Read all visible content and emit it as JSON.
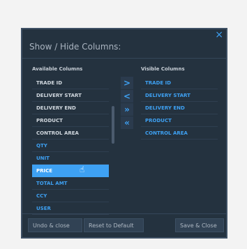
{
  "dialog": {
    "title": "Show / Hide Columns:",
    "close": "×",
    "available_title": "Available Columns",
    "visible_title": "Visible Columns",
    "available": [
      "TRADE ID",
      "DELIVERY START",
      "DELIVERY END",
      "PRODUCT",
      "CONTROL AREA",
      "QTY",
      "UNIT",
      "PRICE",
      "TOTAL AMT",
      "CCY",
      "USER"
    ],
    "visible": [
      "TRADE ID",
      "DELIVERY START",
      "DELIVERY END",
      "PRODUCT",
      "CONTROL AREA"
    ],
    "selected": "PRICE",
    "arrows": [
      ">",
      "<",
      "»",
      "«"
    ],
    "buttons": {
      "undo_close": "Undo & close",
      "reset": "Reset to Default",
      "save_close": "Save & Close"
    }
  },
  "colors": {
    "accent": "#3ea1f3",
    "panel": "#24323f"
  },
  "cursor_icon": "hand-pointer-icon"
}
